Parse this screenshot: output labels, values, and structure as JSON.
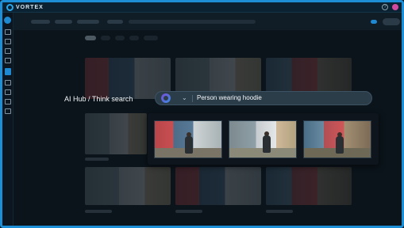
{
  "app": {
    "name": "VORTEX"
  },
  "titlebar": {
    "help_icon": "help-icon",
    "avatar_color": "#d04aa0"
  },
  "theme": {
    "accent": "#1d8fd6",
    "sidebar_active": "#1e88d0"
  },
  "search": {
    "label": "AI Hub / Think search",
    "mode_icon": "ai-gradient-icon",
    "dropdown_icon": "chevron-down-icon",
    "query": "Person wearing hoodie"
  },
  "results": {
    "count": 3,
    "items": [
      {
        "scene": "red-wall-corridor"
      },
      {
        "scene": "doorway-courtyard"
      },
      {
        "scene": "blue-door-street"
      }
    ]
  }
}
